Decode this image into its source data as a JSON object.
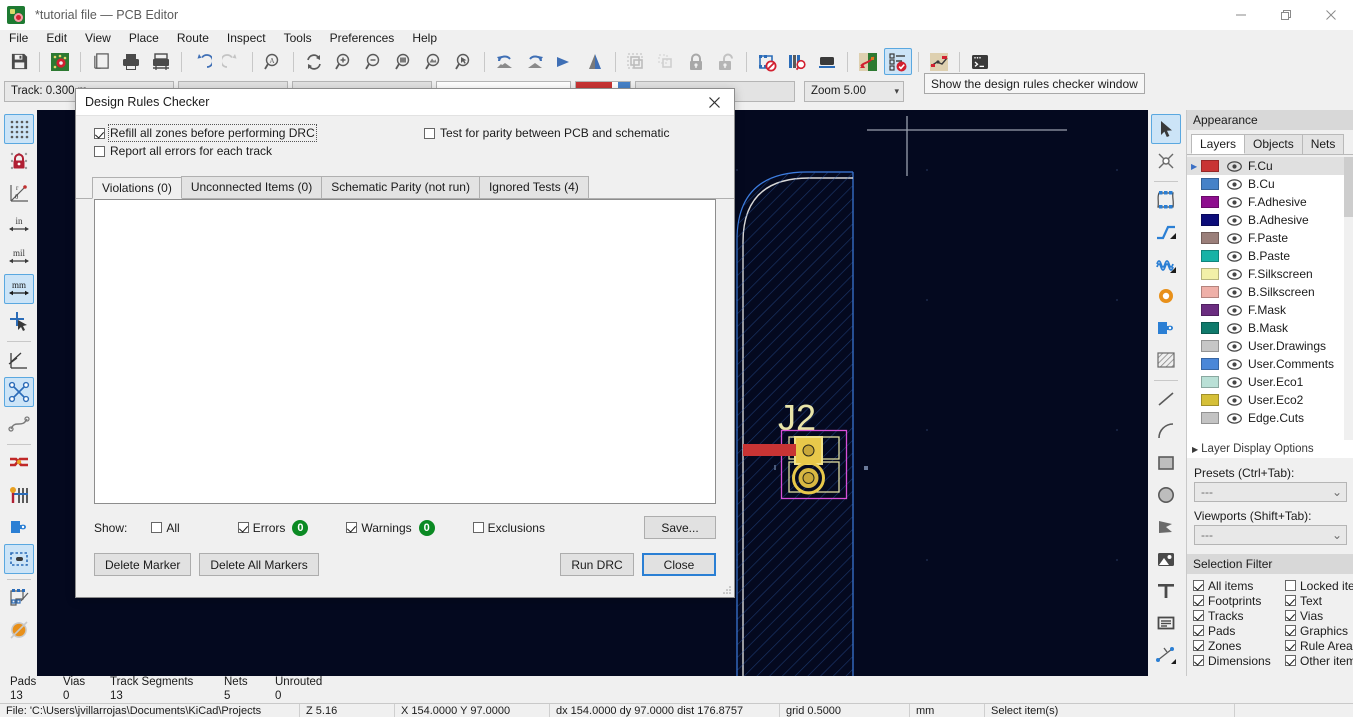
{
  "window": {
    "title": "*tutorial file — PCB Editor",
    "app_icon": "kicad-pcb-icon",
    "minimize": "—",
    "maximize": "❐",
    "close": "✕"
  },
  "menubar": {
    "items": [
      {
        "label": "File"
      },
      {
        "label": "Edit"
      },
      {
        "label": "View"
      },
      {
        "label": "Place"
      },
      {
        "label": "Route"
      },
      {
        "label": "Inspect"
      },
      {
        "label": "Tools"
      },
      {
        "label": "Preferences"
      },
      {
        "label": "Help"
      }
    ]
  },
  "toolbar_top": {
    "buttons": [
      {
        "name": "save-icon"
      },
      {
        "name": "board-setup-icon"
      },
      {
        "name": "page-settings-icon"
      },
      {
        "name": "print-icon"
      },
      {
        "name": "plot-icon"
      },
      {
        "name": "undo-icon"
      },
      {
        "name": "redo-icon"
      },
      {
        "name": "find-icon"
      },
      {
        "name": "refresh-icon"
      },
      {
        "name": "zoom-in-icon"
      },
      {
        "name": "zoom-out-icon"
      },
      {
        "name": "zoom-fit-icon"
      },
      {
        "name": "zoom-objects-icon"
      },
      {
        "name": "zoom-selection-icon"
      },
      {
        "name": "rotate-ccw-icon"
      },
      {
        "name": "rotate-cw-icon"
      },
      {
        "name": "flip-horizontal-icon"
      },
      {
        "name": "mirror-vertical-icon"
      },
      {
        "name": "group-icon"
      },
      {
        "name": "ungroup-icon"
      },
      {
        "name": "lock-icon"
      },
      {
        "name": "unlock-icon"
      },
      {
        "name": "footprint-editor-icon"
      },
      {
        "name": "footprint-library-icon"
      },
      {
        "name": "3d-viewer-icon"
      },
      {
        "name": "update-pcb-icon"
      },
      {
        "name": "drc-icon"
      },
      {
        "name": "net-inspector-icon"
      },
      {
        "name": "scripting-console-icon"
      }
    ]
  },
  "toolbar_aux": {
    "track_label": "Track: 0.300 m",
    "via_value": "",
    "zoom_label": "Zoom 5.00"
  },
  "toolbar_left": {
    "buttons": [
      {
        "name": "toggle-grid-icon",
        "active": true
      },
      {
        "name": "grid-overrides-icon",
        "active": false
      },
      {
        "name": "polar-coords-icon",
        "active": false
      },
      {
        "name": "units-inches-icon",
        "active": false
      },
      {
        "name": "units-mils-icon",
        "active": false
      },
      {
        "name": "units-mm-icon",
        "active": true
      },
      {
        "name": "cursor-shape-icon",
        "active": false
      },
      {
        "name": "ratsnest-mode-icon",
        "active": false
      },
      {
        "name": "show-ratsnest-icon",
        "active": true
      },
      {
        "name": "curved-ratsnest-icon",
        "active": false
      },
      {
        "name": "track-fill-icon",
        "active": false
      },
      {
        "name": "via-fill-icon",
        "active": false
      },
      {
        "name": "pad-fill-icon",
        "active": false
      },
      {
        "name": "zone-outline-icon",
        "active": true
      },
      {
        "name": "footprint-text-icon",
        "active": false
      },
      {
        "name": "hidden-text-icon",
        "active": false
      }
    ]
  },
  "toolbar_right": {
    "buttons": [
      {
        "name": "select-tool-icon",
        "active": true
      },
      {
        "name": "highlight-net-icon",
        "active": false
      },
      {
        "name": "place-footprint-icon",
        "active": false
      },
      {
        "name": "route-track-icon",
        "active": false
      },
      {
        "name": "route-diff-pair-icon",
        "active": false
      },
      {
        "name": "place-via-icon",
        "active": false
      },
      {
        "name": "draw-zone-icon",
        "active": false
      },
      {
        "name": "draw-rule-area-icon",
        "active": false
      },
      {
        "name": "draw-line-icon",
        "active": false
      },
      {
        "name": "draw-arc-icon",
        "active": false
      },
      {
        "name": "draw-rectangle-icon",
        "active": false
      },
      {
        "name": "draw-circle-icon",
        "active": false
      },
      {
        "name": "draw-polygon-icon",
        "active": false
      },
      {
        "name": "place-image-icon",
        "active": false
      },
      {
        "name": "place-text-icon",
        "active": false
      },
      {
        "name": "place-textbox-icon",
        "active": false
      },
      {
        "name": "dimension-icon",
        "active": false
      }
    ]
  },
  "canvas": {
    "footprint_ref": "J2",
    "background": "#04091f"
  },
  "tooltip": {
    "text": "Show the design rules checker window"
  },
  "appearance": {
    "title": "Appearance",
    "tabs": [
      {
        "label": "Layers",
        "selected": true
      },
      {
        "label": "Objects",
        "selected": false
      },
      {
        "label": "Nets",
        "selected": false
      }
    ],
    "layers": [
      {
        "name": "F.Cu",
        "color": "#c83434",
        "selected": true
      },
      {
        "name": "B.Cu",
        "color": "#4682c8",
        "selected": false
      },
      {
        "name": "F.Adhesive",
        "color": "#8e0e8e",
        "selected": false
      },
      {
        "name": "B.Adhesive",
        "color": "#0d0d7a",
        "selected": false
      },
      {
        "name": "F.Paste",
        "color": "#9b7f7a",
        "selected": false
      },
      {
        "name": "B.Paste",
        "color": "#17b2a6",
        "selected": false
      },
      {
        "name": "F.Silkscreen",
        "color": "#f2f0a8",
        "selected": false
      },
      {
        "name": "B.Silkscreen",
        "color": "#efb0a8",
        "selected": false
      },
      {
        "name": "F.Mask",
        "color": "#6b2d80",
        "selected": false
      },
      {
        "name": "B.Mask",
        "color": "#107a6b",
        "selected": false
      },
      {
        "name": "User.Drawings",
        "color": "#c6c6c6",
        "selected": false
      },
      {
        "name": "User.Comments",
        "color": "#4a87d8",
        "selected": false
      },
      {
        "name": "User.Eco1",
        "color": "#b9e0d6",
        "selected": false
      },
      {
        "name": "User.Eco2",
        "color": "#d6c038",
        "selected": false
      },
      {
        "name": "Edge.Cuts",
        "color": "#c3c3c3",
        "selected": false
      }
    ],
    "layer_display_options": "Layer Display Options",
    "presets_label": "Presets (Ctrl+Tab):",
    "presets_value": "---",
    "viewports_label": "Viewports (Shift+Tab):",
    "viewports_value": "---"
  },
  "selection_filter": {
    "title": "Selection Filter",
    "left_column": [
      {
        "label": "All items",
        "checked": true
      },
      {
        "label": "Footprints",
        "checked": true
      },
      {
        "label": "Tracks",
        "checked": true
      },
      {
        "label": "Pads",
        "checked": true
      },
      {
        "label": "Zones",
        "checked": true
      },
      {
        "label": "Dimensions",
        "checked": true
      }
    ],
    "right_column": [
      {
        "label": "Locked items",
        "checked": false
      },
      {
        "label": "Text",
        "checked": true
      },
      {
        "label": "Vias",
        "checked": true
      },
      {
        "label": "Graphics",
        "checked": true
      },
      {
        "label": "Rule Areas",
        "checked": true
      },
      {
        "label": "Other items",
        "checked": true
      }
    ]
  },
  "status_counts": {
    "headers": [
      "Pads",
      "Vias",
      "Track Segments",
      "Nets",
      "Unrouted"
    ],
    "values": [
      "13",
      "0",
      "13",
      "5",
      "0"
    ]
  },
  "status_bar": {
    "segments": [
      "File: 'C:\\Users\\jvillarrojas\\Documents\\KiCad\\Projects",
      "Z 5.16",
      "X 154.0000  Y 97.0000",
      "dx 154.0000  dy 97.0000  dist 176.8757",
      "grid 0.5000",
      "mm",
      "Select item(s)",
      ""
    ]
  },
  "dialog": {
    "title": "Design Rules Checker",
    "close_icon": "close-icon",
    "options": [
      {
        "label": "Refill all zones before performing DRC",
        "checked": true,
        "focused": true
      },
      {
        "label": "Report all errors for each track",
        "checked": false,
        "focused": false
      },
      {
        "label": "Test for parity between PCB and schematic",
        "checked": false,
        "focused": false
      }
    ],
    "tabs": [
      {
        "label": "Violations (0)",
        "selected": true
      },
      {
        "label": "Unconnected Items (0)",
        "selected": false
      },
      {
        "label": "Schematic Parity (not run)",
        "selected": false
      },
      {
        "label": "Ignored Tests (4)",
        "selected": false
      }
    ],
    "results": [],
    "show_label": "Show:",
    "filters": [
      {
        "label": "All",
        "checked": false,
        "count": null
      },
      {
        "label": "Errors",
        "checked": true,
        "count": "0"
      },
      {
        "label": "Warnings",
        "checked": true,
        "count": "0"
      },
      {
        "label": "Exclusions",
        "checked": false,
        "count": null
      }
    ],
    "save_button": "Save...",
    "delete_marker_button": "Delete Marker",
    "delete_all_markers_button": "Delete All Markers",
    "run_drc_button": "Run DRC",
    "close_button": "Close"
  }
}
